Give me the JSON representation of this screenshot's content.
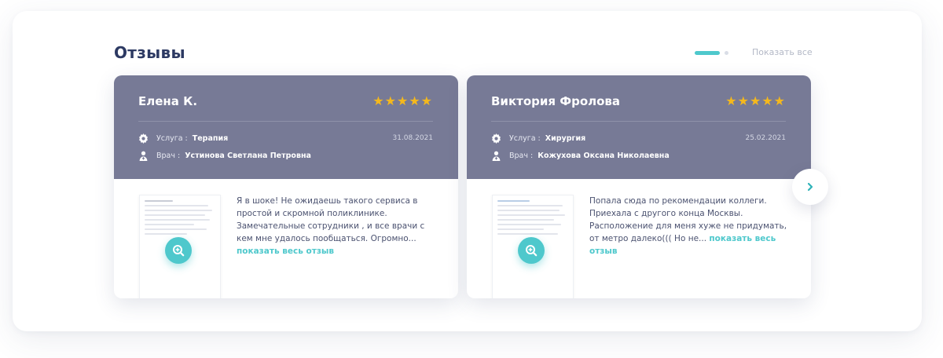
{
  "section": {
    "title": "Отзывы",
    "show_all": "Показать все"
  },
  "reviews": [
    {
      "name": "Елена К.",
      "stars": "★★★★★",
      "rating": 5,
      "service_label": "Услуга :",
      "service": "Терапия",
      "doctor_label": "Врач :",
      "doctor": "Устинова Светлана Петровна",
      "date": "31.08.2021",
      "text": "Я в шоке! Не ожидаешь такого сервиса в простой и скромной поликлинике. Замечательные сотрудники , и все врачи с кем мне удалось пообщаться. Огромно...",
      "more": "показать весь отзыв"
    },
    {
      "name": "Виктория Фролова",
      "stars": "★★★★★",
      "rating": 5,
      "service_label": "Услуга :",
      "service": "Хирургия",
      "doctor_label": "Врач :",
      "doctor": "Кожухова Оксана Николаевна",
      "date": "25.02.2021",
      "text": "Попала сюда по рекомендации коллеги. Приехала с другого конца Москвы. Расположение для меня хуже не придумать, от метро далеко((( Но не...",
      "more": "показать весь отзыв"
    }
  ],
  "colors": {
    "card_header": "#777a96",
    "accent": "#4ec8cc",
    "star": "#f4b81d",
    "title": "#2d3a63"
  },
  "icons": {
    "service": "gear-icon",
    "doctor": "doctor-icon",
    "zoom": "zoom-in-icon",
    "next": "chevron-right-icon"
  }
}
